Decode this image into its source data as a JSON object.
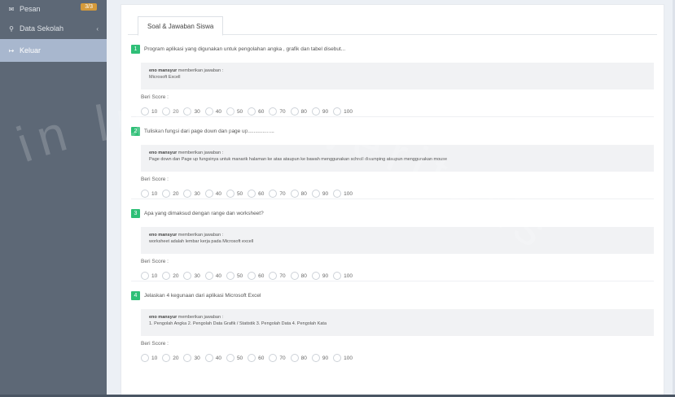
{
  "sidebar": {
    "items": [
      {
        "icon": "envelope-icon",
        "label": "Pesan",
        "badge": "3/3"
      },
      {
        "icon": "search-icon",
        "label": "Data Sekolah",
        "chevron": "‹"
      },
      {
        "icon": "logout-icon",
        "label": "Keluar"
      }
    ]
  },
  "tab": {
    "label": "Soal & Jawaban Siswa"
  },
  "questions": [
    {
      "num": "1",
      "text": "Program aplikasi yang digunakan untuk pengolahan angka , grafik dan tabel disebut...",
      "author": "eno mansyur",
      "author_suffix": " memberikan jawaban :",
      "answer": "Microsoft Excell",
      "score_label": "Beri Score :",
      "options": [
        "10",
        "20",
        "30",
        "40",
        "50",
        "60",
        "70",
        "80",
        "90",
        "100"
      ]
    },
    {
      "num": "2",
      "text": "Tuliskan fungsi dari page down dan page up..................",
      "author": "eno mansyur",
      "author_suffix": " memberikan jawaban :",
      "answer": "Page down dan Page up fungsinya untuk manarik halaman ke atas ataupun ke bawah menggunakan schroll disamping ataupun menggunakan mouse",
      "score_label": "Beri Score :",
      "options": [
        "10",
        "20",
        "30",
        "40",
        "50",
        "60",
        "70",
        "80",
        "90",
        "100"
      ]
    },
    {
      "num": "3",
      "text": "Apa yang dimaksud dengan range dan worksheet?",
      "author": "eno mansyur",
      "author_suffix": " memberikan jawaban :",
      "answer": "worksheet adalah lembar kerja pada Microsoft excell",
      "score_label": "Beri Score :",
      "options": [
        "10",
        "20",
        "30",
        "40",
        "50",
        "60",
        "70",
        "80",
        "90",
        "100"
      ]
    },
    {
      "num": "4",
      "text": "Jelaskan 4 kegunaan dari aplikasi  Microsoft Excel",
      "author": "eno mansyur",
      "author_suffix": " memberikan jawaban :",
      "answer": "1. Pengolah Angka 2. Pengolah Data Grafik / Statistik 3. Pengolah Data 4. Pengolah Kata",
      "score_label": "Beri Score :",
      "options": [
        "10",
        "20",
        "30",
        "40",
        "50",
        "60",
        "70",
        "80",
        "90",
        "100"
      ]
    }
  ],
  "watermark": {
    "text": "in lumine veritatis"
  },
  "colors": {
    "sidebar": "#5d6876",
    "active_item": "#a8b7ce",
    "badge": "#d59a3a",
    "number_badge": "#2fbf77"
  }
}
